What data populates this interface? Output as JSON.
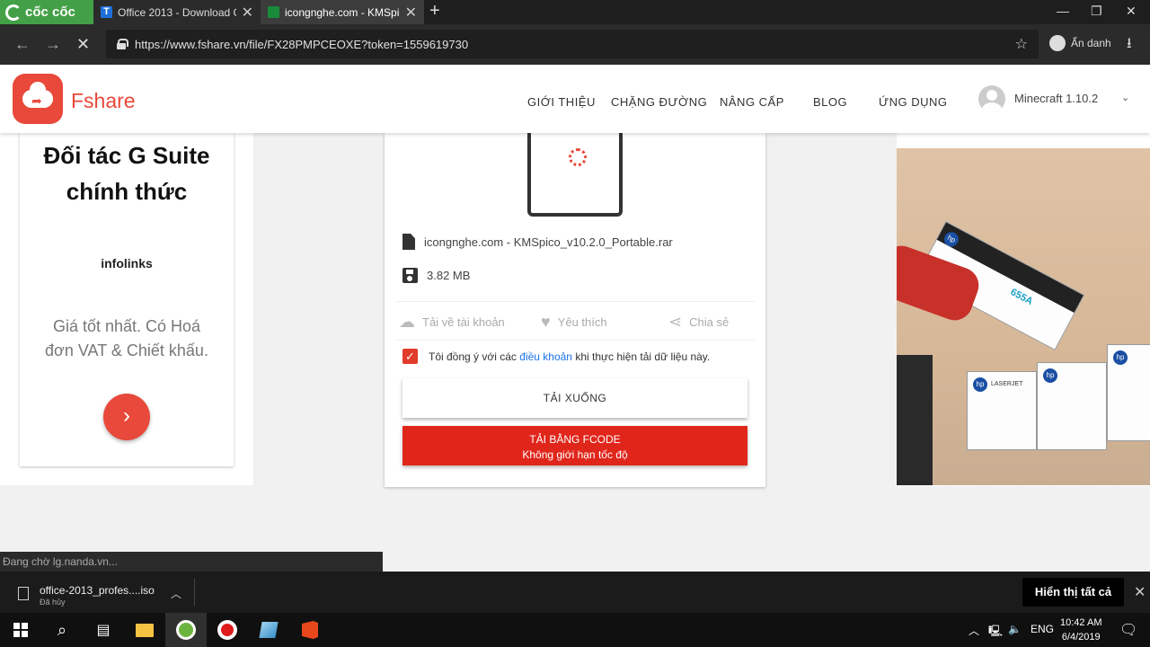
{
  "browser": {
    "brand": "cốc cốc",
    "tabs": [
      {
        "label": "Office 2013 - Download O",
        "favicon": "T"
      },
      {
        "label": "icongnghe.com - KMSpic",
        "favicon": ""
      }
    ],
    "url": "https://www.fshare.vn/file/FX28PMPCEOXE?token=1559619730",
    "incognito_label": "Ẩn danh"
  },
  "site": {
    "logo_text": "Fshare",
    "menu": [
      "GIỚI THIỆU",
      "CHẶNG ĐƯỜNG",
      "NÂNG CẤP",
      "BLOG",
      "ỨNG DỤNG"
    ],
    "username": "Minecraft 1.10.2",
    "accent": "#e8493a"
  },
  "left_ad": {
    "title_line1": "Đối tác G Suite",
    "title_line2": "chính thức",
    "brand": "infolinks",
    "text_line1": "Giá tốt nhất. Có Hoá",
    "text_line2": "đơn VAT & Chiết khấu."
  },
  "file": {
    "name": "icongnghe.com - KMSpico_v10.2.0_Portable.rar",
    "size": "3.82 MB",
    "actions": [
      "Tải về tài khoản",
      "Yêu thích",
      "Chia sẻ"
    ],
    "agree_prefix": "Tôi đồng ý với các",
    "agree_link": "điều khoản",
    "agree_suffix": "khi thực hiện tải dữ liệu này.",
    "download_label": "TẢI XUỐNG",
    "fcode_label": "TẢI BẰNG FCODE",
    "fcode_sub": "Không giới hạn tốc độ",
    "fcode_color": "#e0261b"
  },
  "right_ad": {
    "box_labels": [
      "655A",
      "LASERJET"
    ]
  },
  "status": {
    "text": "Đang chờ lg.nanda.vn..."
  },
  "downloads": {
    "item_name": "office-2013_profes....iso",
    "item_status": "Đã hủy",
    "show_all": "Hiển thị tất cả"
  },
  "taskbar": {
    "lang": "ENG",
    "time": "10:42 AM",
    "date": "6/4/2019"
  }
}
